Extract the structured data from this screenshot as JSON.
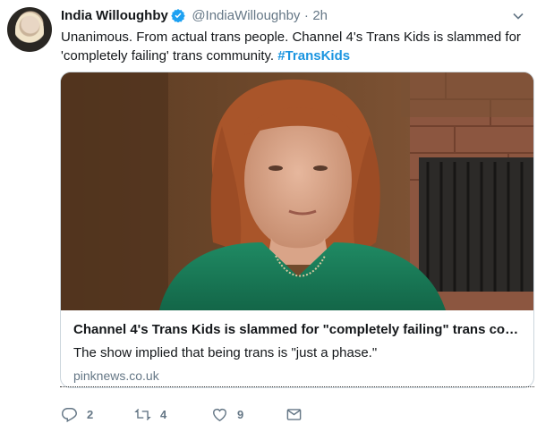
{
  "tweet": {
    "author_name": "India Willoughby",
    "handle": "@IndiaWilloughby",
    "separator": "·",
    "time": "2h",
    "text": "Unanimous. From actual trans people. Channel 4's Trans Kids is slammed for 'completely failing' trans community. ",
    "hashtag": "#TransKids"
  },
  "card": {
    "title": "Channel 4's Trans Kids is slammed for \"completely failing\" trans com...",
    "description": "The show implied that being trans is \"just a phase.\"",
    "domain": "pinknews.co.uk"
  },
  "actions": {
    "reply_count": "2",
    "retweet_count": "4",
    "like_count": "9"
  },
  "colors": {
    "accent": "#1b95e0",
    "muted": "#657786",
    "border": "#ccd6dd",
    "verified": "#1da1f2"
  },
  "icons": {
    "verified": "verified-badge-icon",
    "caret": "chevron-down-icon",
    "reply": "reply-icon",
    "retweet": "retweet-icon",
    "like": "heart-icon",
    "message": "direct-message-icon"
  }
}
